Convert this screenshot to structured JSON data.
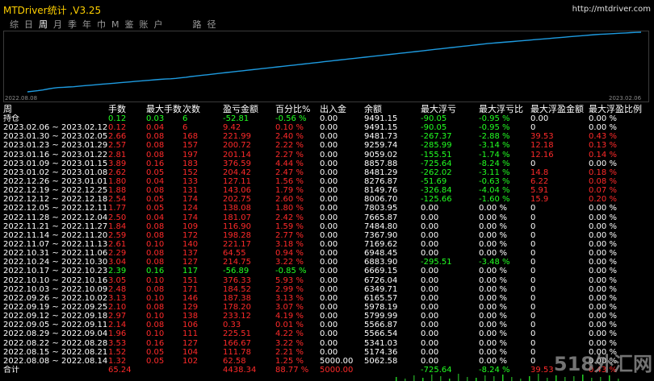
{
  "window": {
    "title": "MTDriver统计 ,V3.25",
    "url": "http://mtdriver.com"
  },
  "tabs": [
    "综",
    "日",
    "周",
    "月",
    "季",
    "年",
    "巾",
    "M",
    "鉴",
    "账",
    "户",
    "路",
    "径"
  ],
  "active_tab": 2,
  "chart": {
    "x_start_label": "2022.08.08",
    "x_end_label": "2023.02.06",
    "line_color": "#1e9be0",
    "points": [
      0,
      0.4,
      0.8,
      1.3,
      2.0,
      2.6,
      3.0,
      3.2,
      3.4,
      3.6,
      3.9,
      4.3,
      4.6,
      4.9,
      5.2,
      5.5,
      5.8,
      6.1,
      6.4,
      6.7,
      7.0,
      7.3,
      7.6,
      7.9,
      8.2,
      8.5,
      8.8,
      9.0,
      9.2,
      9.5,
      9.9,
      10.3,
      10.8,
      11.2,
      11.6,
      12.0,
      12.4,
      12.8,
      13.2,
      13.6,
      14.0,
      14.4,
      14.8,
      15.2,
      15.6,
      16.0,
      16.4,
      16.8,
      17.2,
      17.6,
      18.0,
      18.4,
      18.8,
      19.2,
      19.6,
      20.0,
      20.4,
      20.8,
      21.2,
      21.6,
      22.0,
      22.4,
      22.8,
      23.2,
      23.6,
      24.0,
      24.4,
      24.8,
      25.2,
      25.6,
      26.0,
      26.4,
      26.8,
      27.2,
      27.6,
      28.0,
      28.4,
      28.8,
      29.2,
      29.6,
      30.0,
      30.4,
      30.8,
      31.2,
      31.6,
      32.0,
      32.4,
      32.8,
      33.2,
      33.6,
      34.0,
      34.3,
      34.6,
      34.9,
      35.2,
      35.5,
      35.8,
      36.1,
      36.4,
      36.7,
      37.0,
      37.3,
      37.6,
      37.9,
      38.2,
      38.5,
      38.8,
      39.1,
      39.4,
      39.7,
      40.0,
      40.3,
      40.5,
      40.7,
      40.9,
      41.1,
      41.3,
      41.5,
      41.7,
      41.9,
      42.0
    ]
  },
  "table": {
    "headers": [
      "周",
      "手数",
      "最大手数",
      "次数",
      "盈亏金额",
      "百分比%",
      "出入金",
      "余额",
      "最大浮亏",
      "最大浮亏比",
      "最大浮盈金额",
      "最大浮盈比例"
    ],
    "holding": {
      "label": "持仓",
      "cells": [
        "0.12",
        "0.03",
        "6",
        "-52.81",
        "-0.56 %",
        "0.00",
        "9491.15",
        "-90.05",
        "-0.95 %",
        "0.00",
        "0.00 %"
      ]
    },
    "rows": [
      [
        "2023.02.06 ~ 2023.02.12",
        "0.12",
        "0.04",
        "6",
        "9.42",
        "0.10 %",
        "0.00",
        "9491.15",
        "-90.05",
        "-0.95 %",
        "0",
        "0.00 %"
      ],
      [
        "2023.01.30 ~ 2023.02.05",
        "2.66",
        "0.08",
        "168",
        "221.99",
        "2.40 %",
        "0.00",
        "9481.73",
        "-267.37",
        "-2.88 %",
        "39.53",
        "0.43 %"
      ],
      [
        "2023.01.23 ~ 2023.01.29",
        "2.57",
        "0.08",
        "157",
        "200.72",
        "2.22 %",
        "0.00",
        "9259.74",
        "-285.99",
        "-3.14 %",
        "12.18",
        "0.13 %"
      ],
      [
        "2023.01.16 ~ 2023.01.22",
        "2.81",
        "0.08",
        "197",
        "201.14",
        "2.27 %",
        "0.00",
        "9059.02",
        "-155.51",
        "-1.74 %",
        "12.16",
        "0.14 %"
      ],
      [
        "2023.01.09 ~ 2023.01.15",
        "3.89",
        "0.16",
        "183",
        "376.59",
        "4.44 %",
        "0.00",
        "8857.88",
        "-725.64",
        "-8.24 %",
        "0",
        "0.00 %"
      ],
      [
        "2023.01.02 ~ 2023.01.08",
        "2.62",
        "0.05",
        "152",
        "204.42",
        "2.47 %",
        "0.00",
        "8481.29",
        "-262.02",
        "-3.11 %",
        "14.8",
        "0.18 %"
      ],
      [
        "2022.12.26 ~ 2023.01.01",
        "1.80",
        "0.04",
        "133",
        "127.11",
        "1.56 %",
        "0.00",
        "8276.87",
        "-51.69",
        "-0.63 %",
        "6.22",
        "0.08 %"
      ],
      [
        "2022.12.19 ~ 2022.12.25",
        "1.88",
        "0.08",
        "131",
        "143.06",
        "1.79 %",
        "0.00",
        "8149.76",
        "-326.84",
        "-4.04 %",
        "5.91",
        "0.07 %"
      ],
      [
        "2022.12.12 ~ 2022.12.18",
        "2.54",
        "0.05",
        "174",
        "202.75",
        "2.60 %",
        "0.00",
        "8006.70",
        "-125.66",
        "-1.60 %",
        "15.9",
        "0.20 %"
      ],
      [
        "2022.12.05 ~ 2022.12.11",
        "1.77",
        "0.05",
        "124",
        "138.08",
        "1.80 %",
        "0.00",
        "7803.95",
        "0.00",
        "0.00 %",
        "0",
        "0.00 %"
      ],
      [
        "2022.11.28 ~ 2022.12.04",
        "2.50",
        "0.04",
        "174",
        "181.07",
        "2.42 %",
        "0.00",
        "7665.87",
        "0.00",
        "0.00 %",
        "0",
        "0.00 %"
      ],
      [
        "2022.11.21 ~ 2022.11.27",
        "1.84",
        "0.08",
        "109",
        "116.90",
        "1.59 %",
        "0.00",
        "7484.80",
        "0.00",
        "0.00 %",
        "0",
        "0.00 %"
      ],
      [
        "2022.11.14 ~ 2022.11.20",
        "2.59",
        "0.08",
        "172",
        "198.28",
        "2.77 %",
        "0.00",
        "7367.90",
        "0.00",
        "0.00 %",
        "0",
        "0.00 %"
      ],
      [
        "2022.11.07 ~ 2022.11.13",
        "2.61",
        "0.10",
        "140",
        "221.17",
        "3.18 %",
        "0.00",
        "7169.62",
        "0.00",
        "0.00 %",
        "0",
        "0.00 %"
      ],
      [
        "2022.10.31 ~ 2022.11.06",
        "2.29",
        "0.08",
        "137",
        "64.55",
        "0.94 %",
        "0.00",
        "6948.45",
        "0.00",
        "0.00 %",
        "0",
        "0.00 %"
      ],
      [
        "2022.10.24 ~ 2022.10.30",
        "3.04",
        "0.08",
        "127",
        "214.75",
        "3.22 %",
        "0.00",
        "6883.90",
        "-295.51",
        "-3.48 %",
        "0",
        "0.00 %"
      ],
      [
        "2022.10.17 ~ 2022.10.23",
        "2.39",
        "0.16",
        "117",
        "-56.89",
        "-0.85 %",
        "0.00",
        "6669.15",
        "0.00",
        "0.00 %",
        "0",
        "0.00 %"
      ],
      [
        "2022.10.10 ~ 2022.10.16",
        "3.05",
        "0.10",
        "151",
        "376.33",
        "5.93 %",
        "0.00",
        "6726.04",
        "0.00",
        "0.00 %",
        "0",
        "0.00 %"
      ],
      [
        "2022.10.03 ~ 2022.10.09",
        "2.48",
        "0.08",
        "171",
        "184.52",
        "2.99 %",
        "0.00",
        "6349.71",
        "0.00",
        "0.00 %",
        "0",
        "0.00 %"
      ],
      [
        "2022.09.26 ~ 2022.10.02",
        "3.13",
        "0.10",
        "146",
        "187.38",
        "3.13 %",
        "0.00",
        "6165.57",
        "0.00",
        "0.00 %",
        "0",
        "0.00 %"
      ],
      [
        "2022.09.19 ~ 2022.09.25",
        "2.10",
        "0.08",
        "129",
        "178.20",
        "3.07 %",
        "0.00",
        "5978.19",
        "0.00",
        "0.00 %",
        "0",
        "0.00 %"
      ],
      [
        "2022.09.12 ~ 2022.09.18",
        "2.97",
        "0.10",
        "138",
        "233.12",
        "4.19 %",
        "0.00",
        "5799.99",
        "0.00",
        "0.00 %",
        "0",
        "0.00 %"
      ],
      [
        "2022.09.05 ~ 2022.09.11",
        "2.14",
        "0.08",
        "106",
        "0.33",
        "0.01 %",
        "0.00",
        "5566.87",
        "0.00",
        "0.00 %",
        "0",
        "0.00 %"
      ],
      [
        "2022.08.29 ~ 2022.09.04",
        "1.96",
        "0.10",
        "111",
        "225.51",
        "4.22 %",
        "0.00",
        "5566.54",
        "0.00",
        "0.00 %",
        "0",
        "0.00 %"
      ],
      [
        "2022.08.22 ~ 2022.08.28",
        "3.53",
        "0.16",
        "127",
        "166.67",
        "3.22 %",
        "0.00",
        "5341.03",
        "0.00",
        "0.00 %",
        "0",
        "0.00 %"
      ],
      [
        "2022.08.15 ~ 2022.08.21",
        "1.52",
        "0.05",
        "104",
        "111.78",
        "2.21 %",
        "0.00",
        "5174.36",
        "0.00",
        "0.00 %",
        "0",
        "0.00 %"
      ],
      [
        "2022.08.08 ~ 2022.08.14",
        "1.32",
        "0.05",
        "102",
        "62.58",
        "1.25 %",
        "5000.00",
        "5062.58",
        "0.00",
        "0.00 %",
        "0",
        "0.00 %"
      ]
    ],
    "total": {
      "label": "合计",
      "cells": [
        "65.24",
        "",
        "",
        "4438.34",
        "88.77 %",
        "5000.00",
        "",
        "-725.64",
        "-8.24 %",
        "39.53",
        "0.43 %"
      ]
    }
  },
  "watermark": "518外汇网",
  "colors": {
    "positive": "#ff2a2a",
    "negative": "#22ff22",
    "neutral": "#ffffff",
    "title": "#ffd000"
  }
}
